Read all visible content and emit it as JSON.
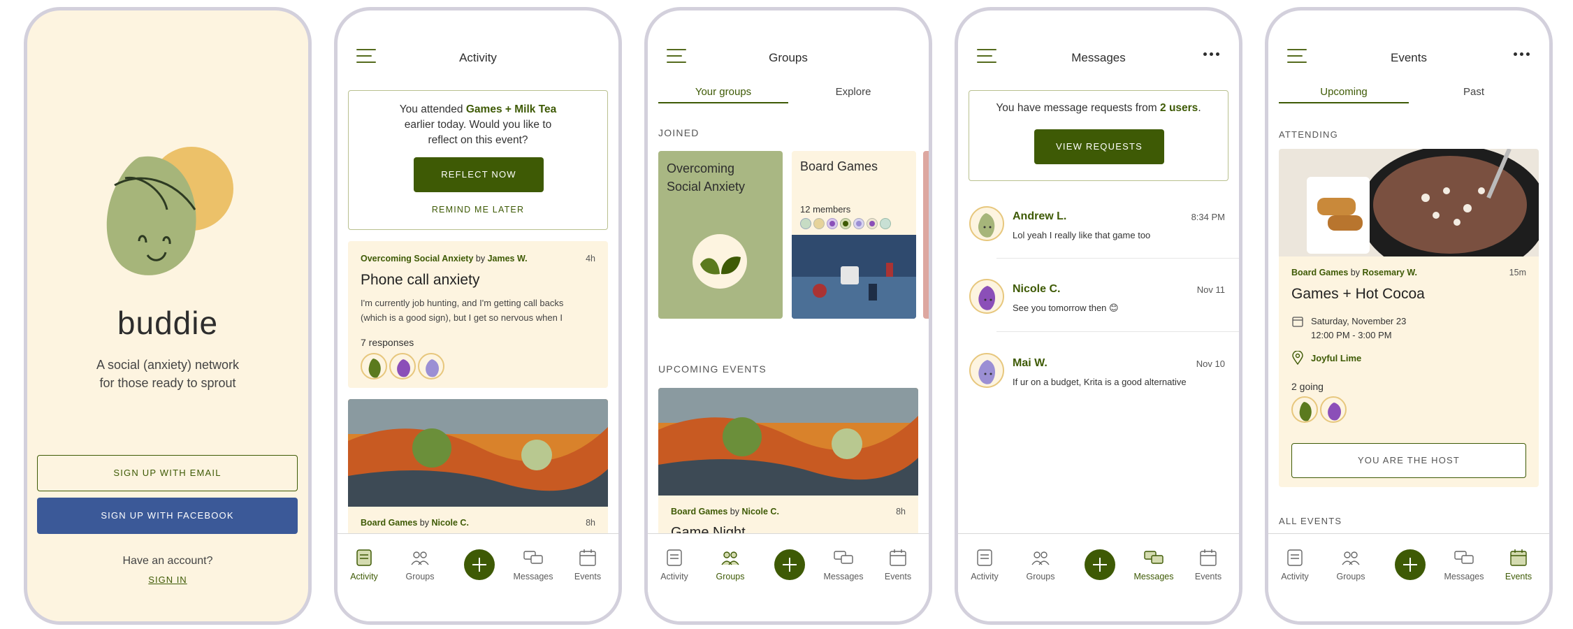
{
  "screen1": {
    "brand": "buddie",
    "tagline_line1": "A social (anxiety) network",
    "tagline_line2": "for those ready to sprout",
    "signup_email": "SIGN UP WITH EMAIL",
    "signup_facebook": "SIGN UP WITH FACEBOOK",
    "have_account": "Have an account?",
    "sign_in": "SIGN IN"
  },
  "screen2": {
    "title": "Activity",
    "reflect": {
      "text_prefix": "You attended ",
      "event_name": "Games + Milk Tea",
      "text_line2": "earlier today. Would you like to",
      "text_line3": "reflect on this event?",
      "reflect_button": "REFLECT NOW",
      "remind_link": "REMIND ME LATER"
    },
    "post": {
      "group": "Overcoming Social Anxiety",
      "by": " by ",
      "author": "James W.",
      "time": "4h",
      "title": "Phone call anxiety",
      "body_line1": "I'm currently job hunting, and I'm getting call backs",
      "body_line2": "(which is a good sign), but I get so nervous when I",
      "responses": "7 responses"
    },
    "event_preview": {
      "group": "Board Games",
      "by": " by ",
      "author": "Nicole C.",
      "time": "8h"
    }
  },
  "screen3": {
    "title": "Groups",
    "tabs": [
      "Your groups",
      "Explore"
    ],
    "joined_label": "JOINED",
    "group1_name_line1": "Overcoming",
    "group1_name_line2": "Social Anxiety",
    "group2_name": "Board Games",
    "group2_members": "12 members",
    "upcoming_label": "UPCOMING EVENTS",
    "event": {
      "group": "Board Games",
      "by": " by ",
      "author": "Nicole C.",
      "time": "8h",
      "title": "Game Night"
    }
  },
  "screen4": {
    "title": "Messages",
    "requests_prefix": "You have message requests from ",
    "requests_count": "2 users",
    "requests_suffix": ".",
    "view_requests": "VIEW REQUESTS",
    "messages": [
      {
        "name": "Andrew L.",
        "time": "8:34 PM",
        "text": "Lol yeah I really like that game too"
      },
      {
        "name": "Nicole C.",
        "time": "Nov 11",
        "text": "See you tomorrow then 😊"
      },
      {
        "name": "Mai W.",
        "time": "Nov 10",
        "text": "If ur on a budget, Krita is a good alternative"
      }
    ]
  },
  "screen5": {
    "title": "Events",
    "tabs": [
      "Upcoming",
      "Past"
    ],
    "attending_label": "ATTENDING",
    "event": {
      "group": "Board Games",
      "by": " by ",
      "author": "Rosemary W.",
      "time": "15m",
      "title": "Games + Hot Cocoa",
      "date": "Saturday, November 23",
      "hours": "12:00 PM - 3:00 PM",
      "location": "Joyful Lime",
      "going": "2 going",
      "host_button": "YOU ARE THE HOST"
    },
    "all_events_label": "ALL EVENTS"
  },
  "tabbar": {
    "activity": "Activity",
    "groups": "Groups",
    "messages": "Messages",
    "events": "Events"
  },
  "colors": {
    "accent": "#3e5a05",
    "cream": "#fdf4e0",
    "facebook": "#3b5998",
    "frame": "#d3d0dc"
  }
}
